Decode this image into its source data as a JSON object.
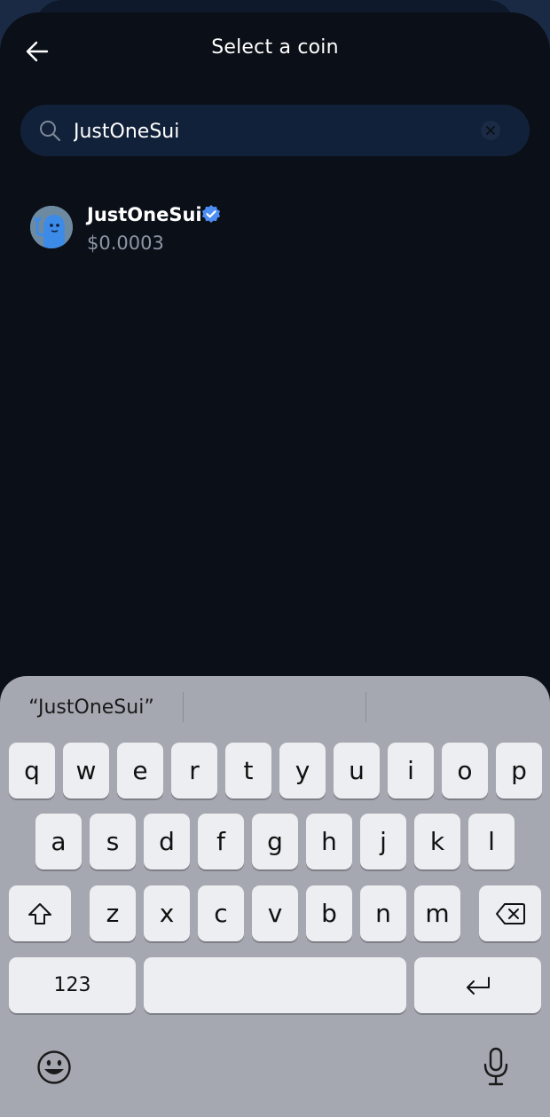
{
  "header": {
    "title": "Select a coin"
  },
  "search": {
    "value": "JustOneSui",
    "placeholder": ""
  },
  "results": [
    {
      "name": "JustOneSui",
      "price": "$0.0003",
      "verified": true
    }
  ],
  "keyboard": {
    "suggestion": "“JustOneSui”",
    "row1": [
      "q",
      "w",
      "e",
      "r",
      "t",
      "y",
      "u",
      "i",
      "o",
      "p"
    ],
    "row2": [
      "a",
      "s",
      "d",
      "f",
      "g",
      "h",
      "j",
      "k",
      "l"
    ],
    "row3": [
      "z",
      "x",
      "c",
      "v",
      "b",
      "n",
      "m"
    ],
    "numbers_label": "123"
  },
  "colors": {
    "background": "#0b0f17",
    "search_bg": "#12213a",
    "verified": "#4d8ef5",
    "keyboard_bg": "#a5a8b0"
  }
}
